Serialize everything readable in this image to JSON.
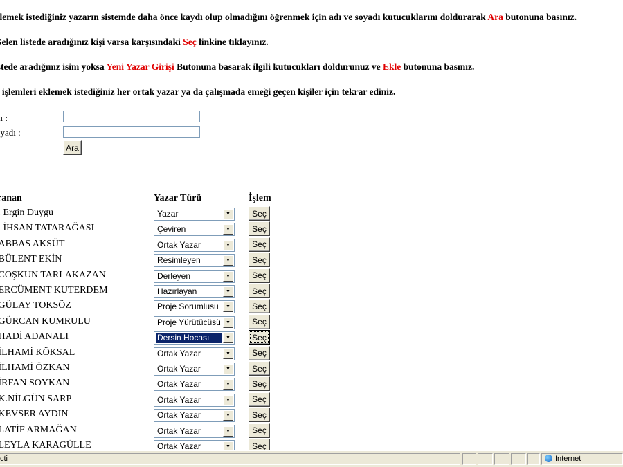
{
  "instructions": [
    {
      "parts": [
        "klemek istediğiniz yazarın sistemde daha önce kaydı olup olmadığını öğrenmek için adı ve soyadı kutucuklarını doldurarak ",
        "Ara",
        " butonuna basınız."
      ]
    },
    {
      "parts": [
        "Gelen listede aradığınız kişi varsa karşısındaki ",
        "Seç",
        " linkine tıklayınız."
      ]
    },
    {
      "parts": [
        "istede aradığınız isim yoksa ",
        "Yeni Yazar Girişi",
        " Butonuna basarak ilgili kutucukları doldurunuz ve ",
        "Ekle",
        " butonuna basınız."
      ]
    },
    {
      "parts": [
        "u işlemleri eklemek istediğiniz her ortak yazar ya da çalışmada emeği geçen kişiler için tekrar ediniz."
      ]
    }
  ],
  "form": {
    "name_label": "dı :",
    "surname_label": "oyadı :",
    "name_value": "",
    "surname_value": "",
    "search_button": "Ara"
  },
  "table": {
    "headers": {
      "name": "ranan",
      "type": "Yazar Türü",
      "action": "İşlem"
    },
    "rows": [
      {
        "name": ".. Ergin Duygu",
        "type": "Yazar",
        "action": "Seç"
      },
      {
        "name": ".. İHSAN TATARAĞASI",
        "type": "Çeviren",
        "action": "Seç"
      },
      {
        "name": ".ABBAS AKSÜT",
        "type": "Ortak Yazar",
        "action": "Seç"
      },
      {
        "name": ".BÜLENT EKİN",
        "type": "Resimleyen",
        "action": "Seç"
      },
      {
        "name": ".COŞKUN TARLAKAZAN",
        "type": "Derleyen",
        "action": "Seç"
      },
      {
        "name": ".ERCÜMENT KUTERDEM",
        "type": "Hazırlayan",
        "action": "Seç"
      },
      {
        "name": ".GÜLAY TOKSÖZ",
        "type": "Proje Sorumlusu",
        "action": "Seç"
      },
      {
        "name": ".GÜRCAN KUMRULU",
        "type": "Proje Yürütücüsü",
        "action": "Seç"
      },
      {
        "name": ".HADİ ADANALI",
        "type": "Dersin Hocası",
        "action": "Seç",
        "highlighted": true
      },
      {
        "name": ".İLHAMİ KÖKSAL",
        "type": "Ortak Yazar",
        "action": "Seç"
      },
      {
        "name": ".İLHAMİ ÖZKAN",
        "type": "Ortak Yazar",
        "action": "Seç"
      },
      {
        "name": ".İRFAN SOYKAN",
        "type": "Ortak Yazar",
        "action": "Seç"
      },
      {
        "name": ".K.NİLGÜN SARP",
        "type": "Ortak Yazar",
        "action": "Seç"
      },
      {
        "name": ".KEVSER AYDIN",
        "type": "Ortak Yazar",
        "action": "Seç"
      },
      {
        "name": ".LATİF ARMAĞAN",
        "type": "Ortak Yazar",
        "action": "Seç"
      },
      {
        "name": ".LEYLA KARAGÜLLE",
        "type": "Ortak Yazar",
        "action": "Seç"
      }
    ]
  },
  "statusbar": {
    "text": "cti",
    "zone": "Internet",
    "zone_icon": "globe-icon"
  },
  "colors": {
    "accent_red": "#e00000",
    "selection": "#0a246a",
    "chrome": "#ece9d8"
  }
}
